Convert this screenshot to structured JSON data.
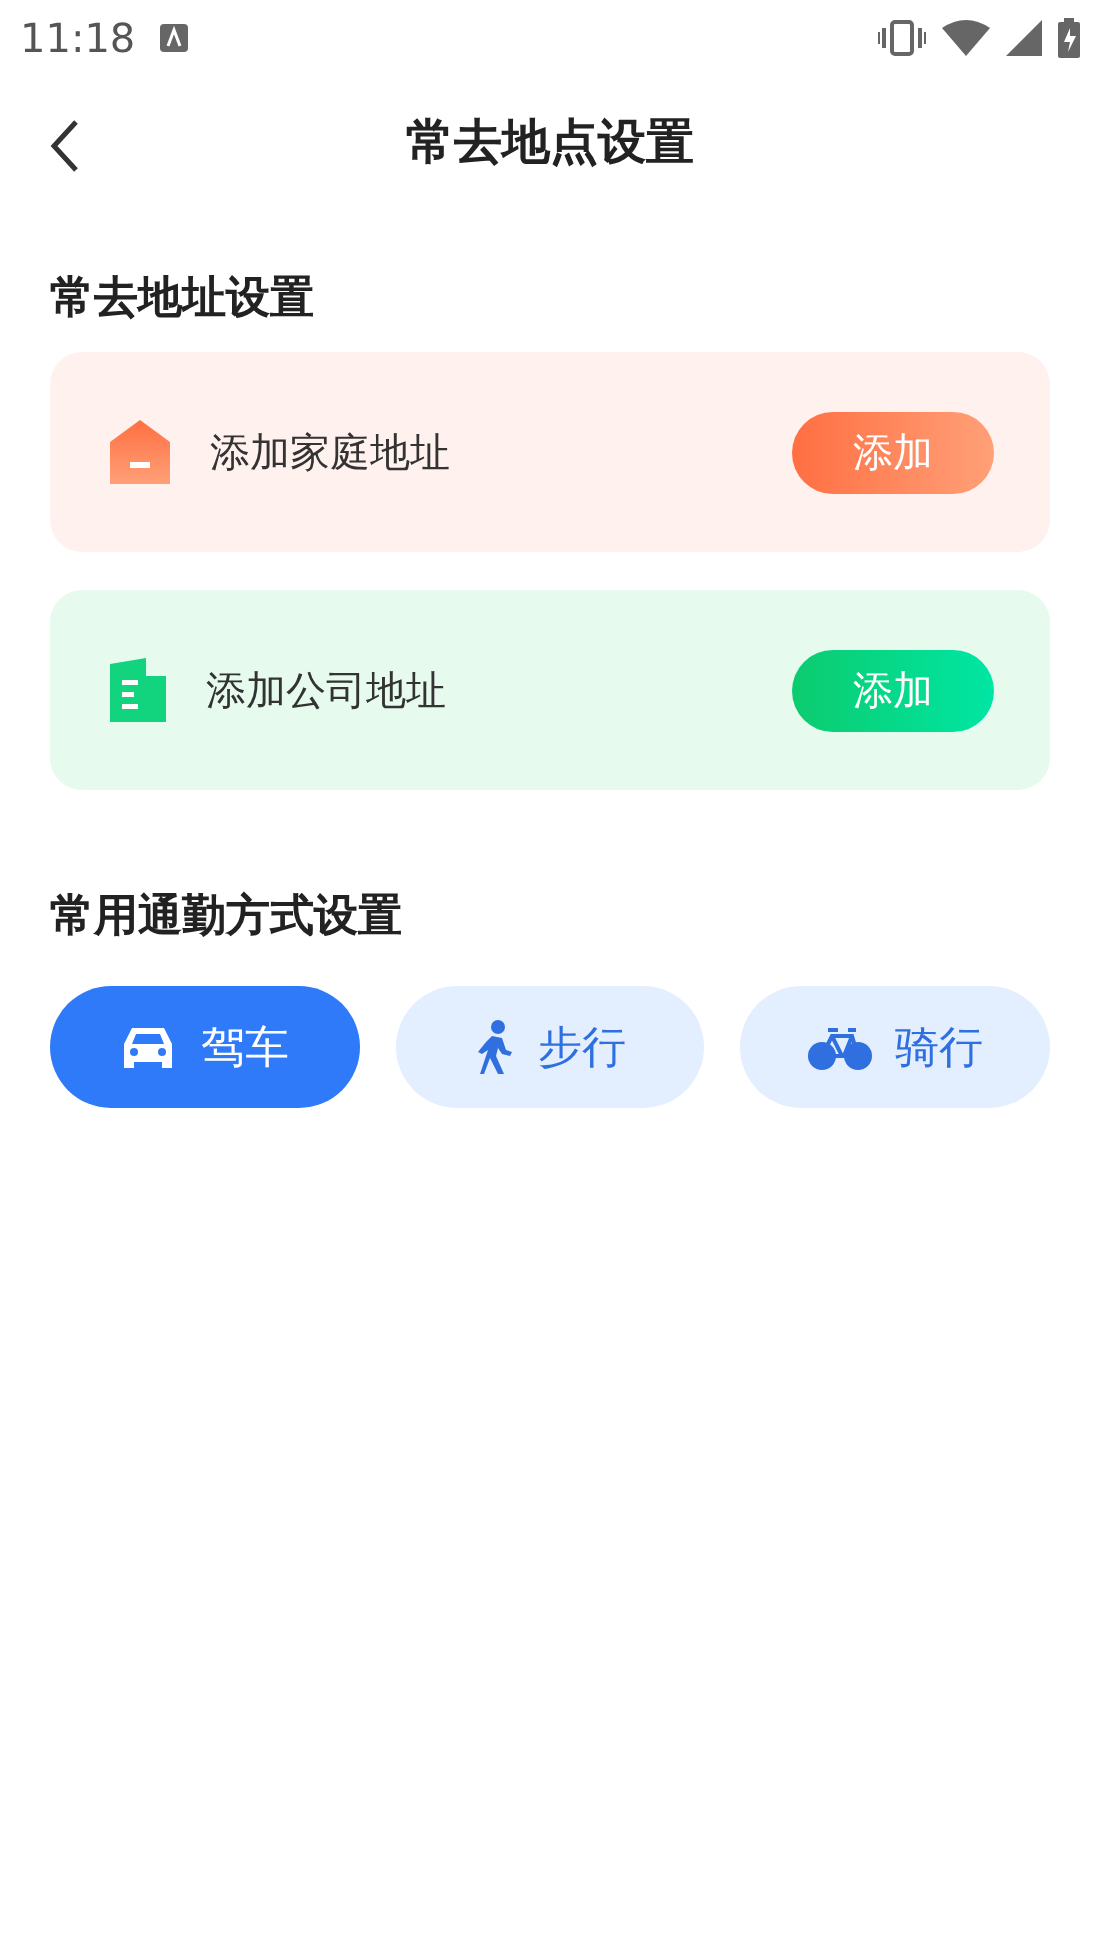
{
  "status_bar": {
    "time": "11:18"
  },
  "header": {
    "title": "常去地点设置"
  },
  "address_section": {
    "title": "常去地址设置",
    "items": [
      {
        "kind": "home",
        "label": "添加家庭地址",
        "button": "添加"
      },
      {
        "kind": "company",
        "label": "添加公司地址",
        "button": "添加"
      }
    ]
  },
  "commute_section": {
    "title": "常用通勤方式设置",
    "modes": [
      {
        "kind": "car",
        "label": "驾车",
        "selected": true
      },
      {
        "kind": "walk",
        "label": "步行",
        "selected": false
      },
      {
        "kind": "bike",
        "label": "骑行",
        "selected": false
      }
    ]
  }
}
